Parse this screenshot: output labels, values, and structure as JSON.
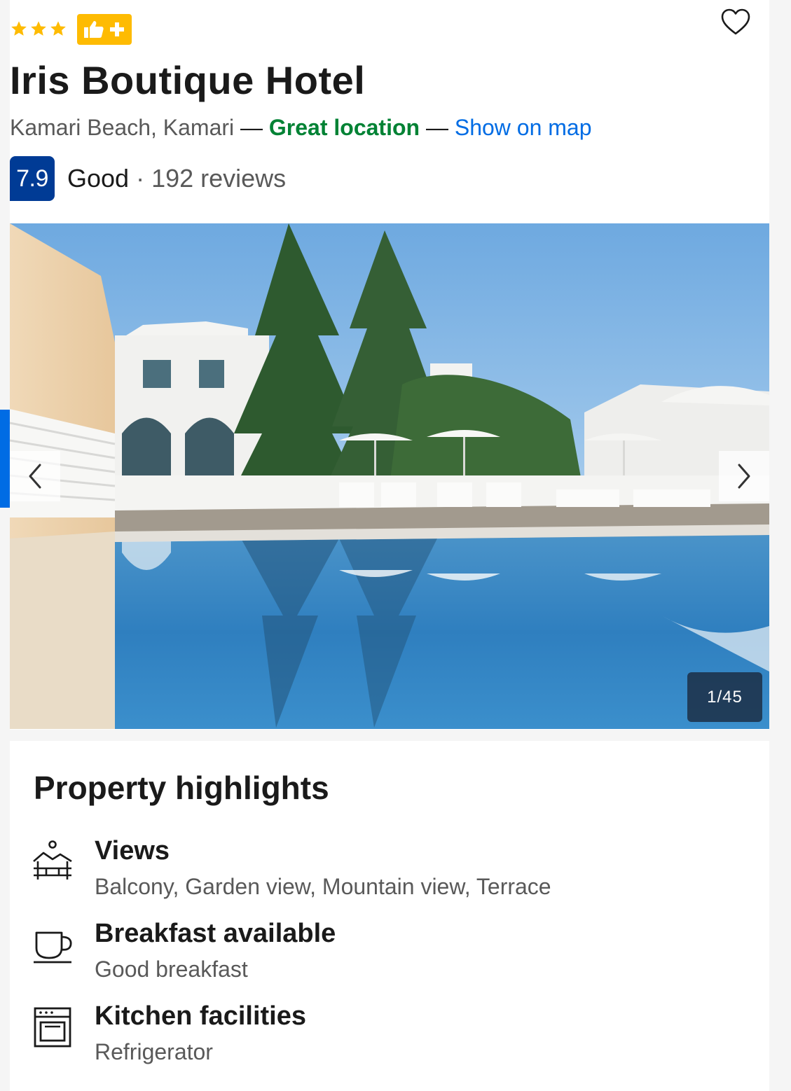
{
  "property": {
    "star_count": 3,
    "name": "Iris Boutique Hotel",
    "location": "Kamari Beach, Kamari",
    "location_dash_1": "—",
    "location_badge": "Great location",
    "location_dash_2": "—",
    "map_link": "Show on map",
    "score": "7.9",
    "score_word": "Good",
    "score_separator": "·",
    "review_count": "192 reviews"
  },
  "gallery": {
    "counter": "1/45"
  },
  "highlights": {
    "title": "Property highlights",
    "items": [
      {
        "icon": "views-icon",
        "title": "Views",
        "detail": "Balcony, Garden view, Mountain view, Terrace"
      },
      {
        "icon": "coffee-cup-icon",
        "title": "Breakfast available",
        "detail": "Good breakfast"
      },
      {
        "icon": "oven-icon",
        "title": "Kitchen facilities",
        "detail": "Refrigerator"
      }
    ]
  },
  "colors": {
    "star": "#febb02",
    "score_box": "#003b95",
    "great_location": "#008234",
    "link": "#006ce4",
    "muted_text": "#595959"
  }
}
